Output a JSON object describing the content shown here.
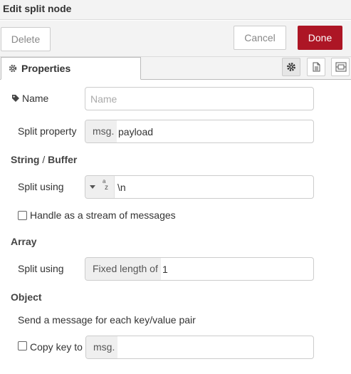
{
  "dialog": {
    "title": "Edit split node",
    "delete_label": "Delete",
    "cancel_label": "Cancel",
    "done_label": "Done"
  },
  "tabs": {
    "properties_label": "Properties"
  },
  "form": {
    "name": {
      "label": "Name",
      "placeholder": "Name",
      "value": ""
    },
    "split_property": {
      "label": "Split property",
      "prefix": "msg.",
      "value": "payload"
    },
    "string_section": {
      "part1": "String",
      "sep": " / ",
      "part2": "Buffer"
    },
    "string_split": {
      "label": "Split using",
      "type_icon": "a z",
      "value": "\\n"
    },
    "stream_checkbox": {
      "label": "Handle as a stream of messages",
      "checked": false
    },
    "array_section": "Array",
    "array_split": {
      "label": "Split using",
      "prefix": "Fixed length of",
      "value": "1"
    },
    "object_section": "Object",
    "object_desc": "Send a message for each key/value pair",
    "copy_key": {
      "label": "Copy key to",
      "prefix": "msg.",
      "value": "",
      "checked": false
    }
  },
  "colors": {
    "done_button": "#ad1625",
    "toolbar_bg": "#f3f3f3"
  }
}
